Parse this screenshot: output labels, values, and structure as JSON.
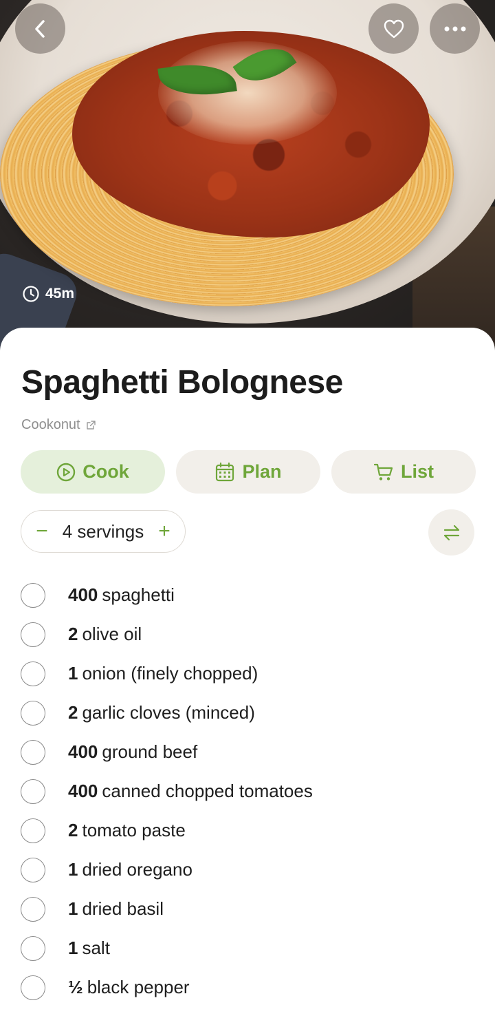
{
  "hero": {
    "time": "45m",
    "icons": {
      "back": "chevron-left-icon",
      "favorite": "heart-icon",
      "more": "more-dots-icon",
      "time": "clock-icon"
    }
  },
  "recipe": {
    "title": "Spaghetti Bolognese",
    "source": "Cookonut"
  },
  "actions": {
    "cook": "Cook",
    "plan": "Plan",
    "list": "List"
  },
  "servings": {
    "label": "4 servings",
    "minus": "−",
    "plus": "+"
  },
  "ingredients": [
    {
      "qty": "400",
      "name": "spaghetti"
    },
    {
      "qty": "2",
      "name": "olive oil"
    },
    {
      "qty": "1",
      "name": "onion (finely chopped)"
    },
    {
      "qty": "2",
      "name": "garlic cloves (minced)"
    },
    {
      "qty": "400",
      "name": "ground beef"
    },
    {
      "qty": "400",
      "name": "canned chopped tomatoes"
    },
    {
      "qty": "2",
      "name": "tomato paste"
    },
    {
      "qty": "1",
      "name": "dried oregano"
    },
    {
      "qty": "1",
      "name": "dried basil"
    },
    {
      "qty": "1",
      "name": "salt"
    },
    {
      "qty": "½",
      "name": "black pepper"
    }
  ],
  "colors": {
    "accent": "#6fa63a",
    "chip": "#f2efea",
    "chip_primary": "#e5f0db"
  }
}
